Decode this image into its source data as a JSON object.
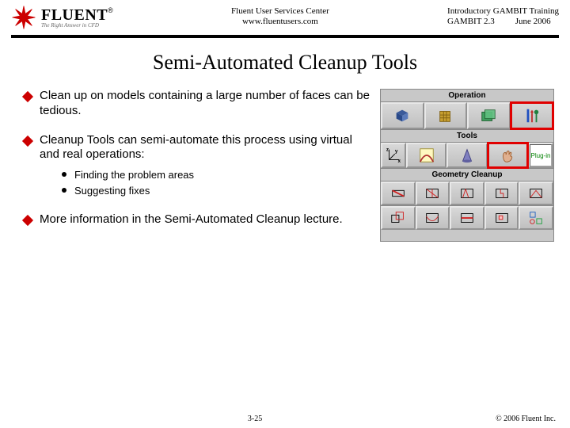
{
  "header": {
    "logo_main": "FLUENT",
    "logo_reg": "®",
    "logo_sub": "The Right Answer in CFD",
    "center_line1": "Fluent User Services Center",
    "center_line2": "www.fluentusers.com",
    "right_line1": "Introductory GAMBIT Training",
    "right_gambit": "GAMBIT 2.3",
    "right_date": "June 2006"
  },
  "title": "Semi-Automated Cleanup Tools",
  "bullets": [
    {
      "text": "Clean up on models containing a large number of faces can be tedious."
    },
    {
      "text": "Cleanup Tools can semi-automate this process using virtual and real operations:",
      "subs": [
        "Finding the problem areas",
        "Suggesting fixes"
      ]
    },
    {
      "text": "More information in the Semi-Automated Cleanup lecture."
    }
  ],
  "panels": {
    "operation": "Operation",
    "tools": "Tools",
    "cleanup": "Geometry Cleanup",
    "plugin_label": "Plug-in"
  },
  "footer": {
    "page": "3-25",
    "copyright": "© 2006 Fluent Inc."
  }
}
